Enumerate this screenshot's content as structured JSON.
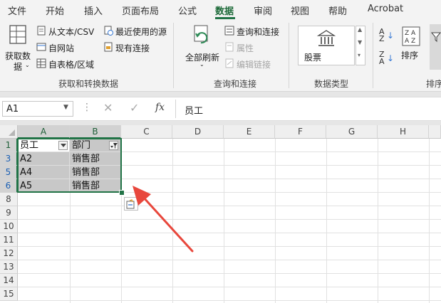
{
  "tabs": [
    "文件",
    "开始",
    "插入",
    "页面布局",
    "公式",
    "数据",
    "审阅",
    "视图",
    "帮助",
    "Acrobat"
  ],
  "active_tab": "数据",
  "ribbon": {
    "get_data_label": "获取数\n据",
    "from_text_csv": "从文本/CSV",
    "from_web": "自网站",
    "from_table": "自表格/区域",
    "recent_sources": "最近使用的源",
    "existing_connections": "现有连接",
    "group_get_transform": "获取和转换数据",
    "refresh_all": "全部刷新",
    "queries_connections": "查询和连接",
    "properties": "属性",
    "edit_links": "编辑链接",
    "group_queries": "查询和连接",
    "stocks": "股票",
    "group_data_types": "数据类型",
    "sort": "排序",
    "group_sort_filter": "排序"
  },
  "formula_bar": {
    "name_box": "A1",
    "fx": "fx",
    "content": "员工"
  },
  "columns": [
    "A",
    "B",
    "C",
    "D",
    "E",
    "F",
    "G",
    "H"
  ],
  "row_numbers": [
    "1",
    "3",
    "5",
    "6",
    "8",
    "9",
    "10",
    "11",
    "12",
    "13",
    "14",
    "15"
  ],
  "cells": {
    "A1": "员工",
    "B1": "部门",
    "A3": "A2",
    "B3": "销售部",
    "A5": "A4",
    "B5": "销售部",
    "A6": "A5",
    "B6": "销售部"
  },
  "colors": {
    "excel_green": "#217346",
    "annotation_red": "#e8473c",
    "filtered_row_blue": "#1a5fb4"
  }
}
